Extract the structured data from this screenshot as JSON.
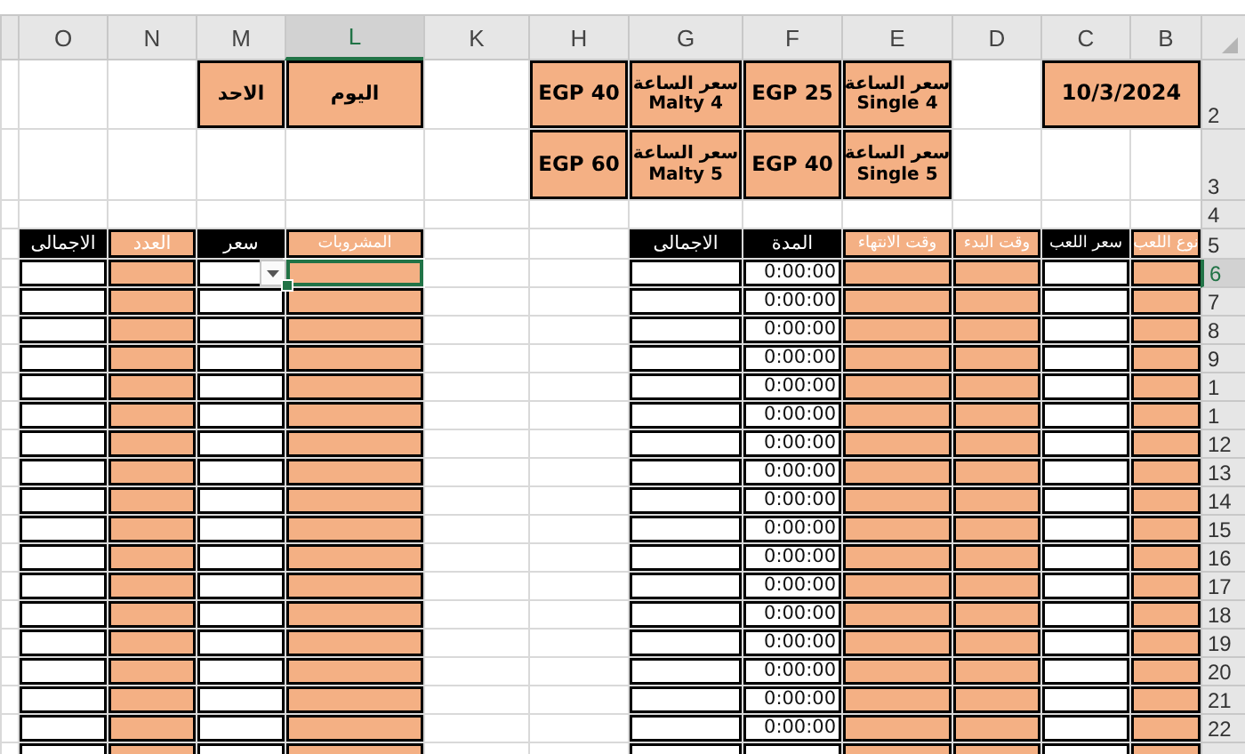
{
  "column_headers": [
    {
      "label": "B",
      "selected": false
    },
    {
      "label": "C",
      "selected": false
    },
    {
      "label": "D",
      "selected": false
    },
    {
      "label": "E",
      "selected": false
    },
    {
      "label": "F",
      "selected": false
    },
    {
      "label": "G",
      "selected": false
    },
    {
      "label": "H",
      "selected": false
    },
    {
      "label": "K",
      "selected": false
    },
    {
      "label": "L",
      "selected": true
    },
    {
      "label": "M",
      "selected": false
    },
    {
      "label": "N",
      "selected": false
    },
    {
      "label": "O",
      "selected": false
    }
  ],
  "row_headers": [
    {
      "label": "2",
      "selected": false
    },
    {
      "label": "3",
      "selected": false
    },
    {
      "label": "4",
      "selected": false
    },
    {
      "label": "5",
      "selected": false
    },
    {
      "label": "6",
      "selected": true
    },
    {
      "label": "7",
      "selected": false
    },
    {
      "label": "8",
      "selected": false
    },
    {
      "label": "9",
      "selected": false
    },
    {
      "label": "1",
      "selected": false
    },
    {
      "label": "1",
      "selected": false
    },
    {
      "label": "12",
      "selected": false
    },
    {
      "label": "13",
      "selected": false
    },
    {
      "label": "14",
      "selected": false
    },
    {
      "label": "15",
      "selected": false
    },
    {
      "label": "16",
      "selected": false
    },
    {
      "label": "17",
      "selected": false
    },
    {
      "label": "18",
      "selected": false
    },
    {
      "label": "19",
      "selected": false
    },
    {
      "label": "20",
      "selected": false
    },
    {
      "label": "21",
      "selected": false
    },
    {
      "label": "22",
      "selected": false
    }
  ],
  "date": "10/3/2024",
  "rates": [
    {
      "label": "سعر الساعة",
      "name": "Single 4",
      "price": "EGP 25"
    },
    {
      "label": "سعر الساعة",
      "name": "Malty 4",
      "price": "EGP 40"
    },
    {
      "label": "سعر الساعة",
      "name": "Single 5",
      "price": "EGP 40"
    },
    {
      "label": "سعر الساعة",
      "name": "Malty 5",
      "price": "EGP 60"
    }
  ],
  "day": {
    "label": "اليوم",
    "value": "الاحد"
  },
  "games_table": {
    "headers": [
      {
        "text": "نوع اللعب",
        "kind": "accent"
      },
      {
        "text": "سعر اللعب",
        "kind": "dark"
      },
      {
        "text": "وقت البدء",
        "kind": "accent"
      },
      {
        "text": "وقت الانتهاء",
        "kind": "accent"
      },
      {
        "text": "المدة",
        "kind": "dark"
      },
      {
        "text": "الاجمالى",
        "kind": "dark"
      }
    ],
    "rows": [
      {
        "duration": "0:00:00"
      },
      {
        "duration": "0:00:00"
      },
      {
        "duration": "0:00:00"
      },
      {
        "duration": "0:00:00"
      },
      {
        "duration": "0:00:00"
      },
      {
        "duration": "0:00:00"
      },
      {
        "duration": "0:00:00"
      },
      {
        "duration": "0:00:00"
      },
      {
        "duration": "0:00:00"
      },
      {
        "duration": "0:00:00"
      },
      {
        "duration": "0:00:00"
      },
      {
        "duration": "0:00:00"
      },
      {
        "duration": "0:00:00"
      },
      {
        "duration": "0:00:00"
      },
      {
        "duration": "0:00:00"
      },
      {
        "duration": "0:00:00"
      },
      {
        "duration": "0:00:00"
      }
    ]
  },
  "drinks_table": {
    "headers": [
      {
        "text": "المشروبات",
        "kind": "accent"
      },
      {
        "text": "سعر",
        "kind": "dark"
      },
      {
        "text": "العدد",
        "kind": "accent"
      },
      {
        "text": "الاجمالى",
        "kind": "dark"
      }
    ],
    "rows": [
      {
        "selected": true,
        "dropdown": true
      },
      {
        "selected": false,
        "dropdown": false
      },
      {
        "selected": false,
        "dropdown": false
      },
      {
        "selected": false,
        "dropdown": false
      },
      {
        "selected": false,
        "dropdown": false
      },
      {
        "selected": false,
        "dropdown": false
      },
      {
        "selected": false,
        "dropdown": false
      },
      {
        "selected": false,
        "dropdown": false
      },
      {
        "selected": false,
        "dropdown": false
      },
      {
        "selected": false,
        "dropdown": false
      },
      {
        "selected": false,
        "dropdown": false
      },
      {
        "selected": false,
        "dropdown": false
      },
      {
        "selected": false,
        "dropdown": false
      },
      {
        "selected": false,
        "dropdown": false
      },
      {
        "selected": false,
        "dropdown": false
      },
      {
        "selected": false,
        "dropdown": false
      },
      {
        "selected": false,
        "dropdown": false
      }
    ]
  }
}
